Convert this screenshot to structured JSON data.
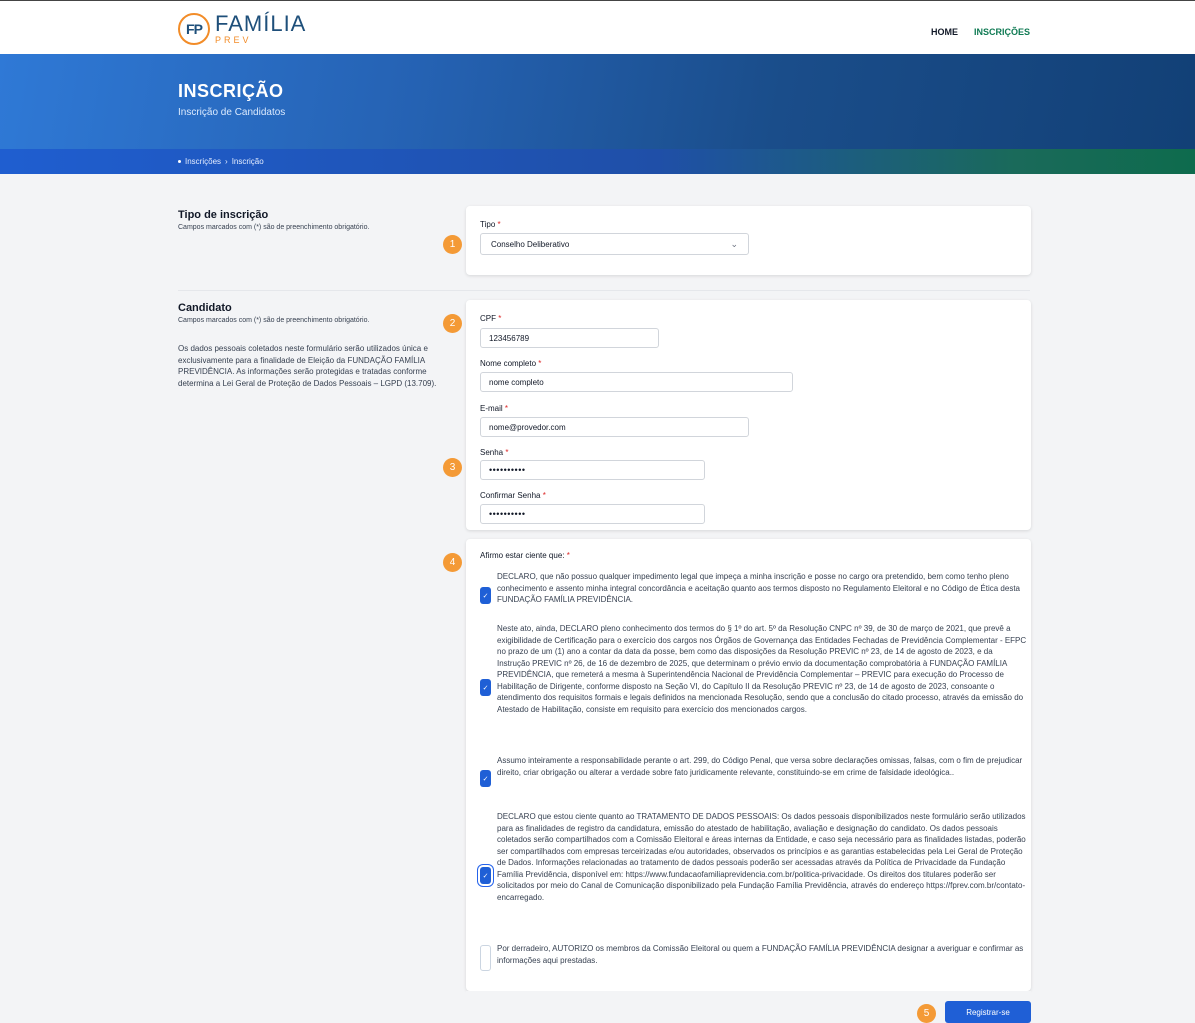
{
  "header": {
    "logo_mark": "FP",
    "logo_main": "FAMÍLIA",
    "logo_sub": "PREV",
    "nav": [
      {
        "label": "HOME",
        "active": false
      },
      {
        "label": "INSCRIÇÕES",
        "active": true
      }
    ]
  },
  "hero": {
    "title": "INSCRIÇÃO",
    "subtitle": "Inscrição de Candidatos",
    "breadcrumb": [
      "Inscrições",
      "Inscrição"
    ],
    "breadcrumb_sep": "›"
  },
  "section_tipo": {
    "title": "Tipo de inscrição",
    "hint": "Campos marcados com (*) são de preenchimento obrigatório.",
    "field_label": "Tipo",
    "field_value": "Conselho Deliberativo"
  },
  "section_candidato": {
    "title": "Candidato",
    "hint": "Campos marcados com (*) são de preenchimento obrigatório.",
    "paragraph": "Os dados pessoais coletados neste formulário serão utilizados única e exclusivamente para a finalidade de Eleição da FUNDAÇÃO FAMÍLIA PREVIDÊNCIA. As informações serão protegidas e tratadas conforme determina a Lei Geral de Proteção de Dados Pessoais – LGPD (13.709).",
    "fields": {
      "cpf": {
        "label": "CPF",
        "value": "123456789"
      },
      "nome": {
        "label": "Nome completo",
        "value": "nome completo"
      },
      "email": {
        "label": "E-mail",
        "value": "nome@provedor.com"
      },
      "senha": {
        "label": "Senha",
        "value": "••••••••••"
      },
      "confirmar": {
        "label": "Confirmar Senha",
        "value": "••••••••••"
      }
    }
  },
  "declaracoes": {
    "label": "Afirmo estar ciente que:",
    "items": [
      {
        "checked": true,
        "text": "DECLARO, que não possuo qualquer impedimento legal que impeça a minha inscrição e posse no cargo ora pretendido, bem como tenho pleno conhecimento e assento minha integral concordância e aceitação quanto aos termos disposto no Regulamento Eleitoral e no Código de Ética desta FUNDAÇÃO FAMÍLIA PREVIDÊNCIA."
      },
      {
        "checked": true,
        "text": "Neste ato, ainda, DECLARO pleno conhecimento dos termos do § 1º do art. 5º da Resolução CNPC nº 39, de 30 de março de 2021, que prevê a exigibilidade de Certificação para o exercício dos cargos nos Órgãos de Governança das Entidades Fechadas de Previdência Complementar - EFPC no prazo de um (1) ano a contar da data da posse, bem como das disposições da Resolução PREVIC nº 23, de 14 de agosto de 2023, e da Instrução PREVIC nº 26, de 16 de dezembro de 2025, que determinam o prévio envio da documentação comprobatória à FUNDAÇÃO FAMÍLIA PREVIDÊNCIA, que remeterá a mesma à Superintendência Nacional de Previdência Complementar – PREVIC para execução do Processo de Habilitação de Dirigente, conforme disposto na Seção VI, do Capítulo II da Resolução PREVIC nº 23, de 14 de agosto de 2023, consoante o atendimento dos requisitos formais e legais definidos na mencionada Resolução, sendo que a conclusão do citado processo, através da emissão do Atestado de Habilitação, consiste em requisito para exercício dos mencionados cargos."
      },
      {
        "checked": true,
        "text": "Assumo inteiramente a responsabilidade perante o art. 299, do Código Penal, que versa sobre declarações omissas, falsas, com o fim de prejudicar direito, criar obrigação ou alterar a verdade sobre fato juridicamente relevante, constituindo-se em crime de falsidade ideológica.."
      },
      {
        "checked": true,
        "text": "DECLARO que estou ciente quanto ao TRATAMENTO DE DADOS PESSOAIS: Os dados pessoais disponibilizados neste formulário serão utilizados para as finalidades de registro da candidatura, emissão do atestado de habilitação, avaliação e designação do candidato. Os dados pessoais coletados serão compartilhados com a Comissão Eleitoral e áreas internas da Entidade, e caso seja necessário para as finalidades listadas, poderão ser compartilhados com empresas terceirizadas e/ou autoridades, observados os princípios e as garantias estabelecidas pela Lei Geral de Proteção de Dados. Informações relacionadas ao tratamento de dados pessoais poderão ser acessadas através da Política de Privacidade da Fundação Família Previdência, disponível em: https://www.fundacaofamiliaprevidencia.com.br/politica-privacidade. Os direitos dos titulares poderão ser solicitados por meio do Canal de Comunicação disponibilizado pela Fundação Família Previdência, através do endereço https://fprev.com.br/contato-encarregado."
      },
      {
        "checked": false,
        "text": "Por derradeiro, AUTORIZO os membros da Comissão Eleitoral ou quem a FUNDAÇÃO FAMÍLIA PREVIDÊNCIA designar a averiguar e confirmar as informações aqui prestadas."
      }
    ]
  },
  "submit": {
    "label": "Registrar-se"
  },
  "badges": [
    "1",
    "2",
    "3",
    "4",
    "5"
  ],
  "required_mark": "*",
  "check_glyph": "✓",
  "chevron_glyph": "⌄",
  "colors": {
    "primary": "#1f5fd6",
    "accent": "#f49a36",
    "active_nav": "#0f7a53",
    "required": "#dc2626"
  }
}
